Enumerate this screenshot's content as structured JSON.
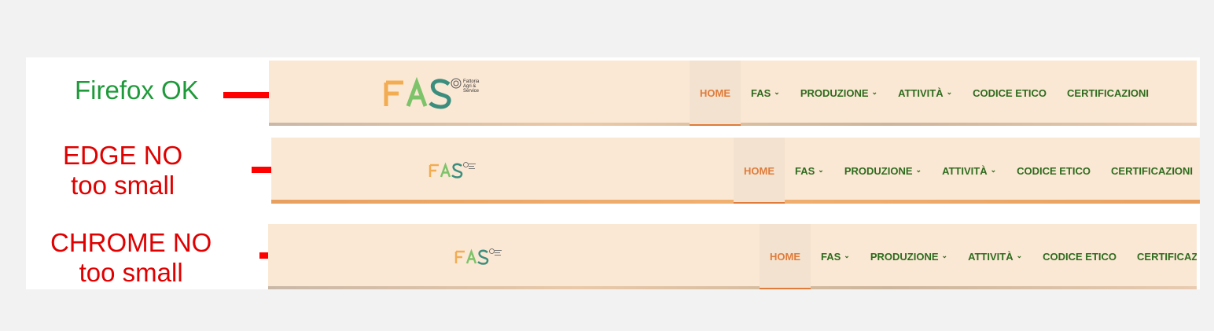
{
  "captions": {
    "firefox": {
      "line1": "Firefox OK",
      "line2": ""
    },
    "edge": {
      "line1": "EDGE NO",
      "line2": "too small"
    },
    "chrome": {
      "line1": "CHROME NO",
      "line2": "too small"
    }
  },
  "logo": {
    "letters": "FAS",
    "tagline_1": "Fattoria",
    "tagline_2": "Agri &",
    "tagline_3": "Service"
  },
  "nav": {
    "home": "HOME",
    "fas": "FAS",
    "produzione": "PRODUZIONE",
    "attivita": "ATTIVITÀ",
    "codice_etico": "CODICE ETICO",
    "certificazioni": "CERTIFICAZIONI",
    "chevron": "⌄"
  },
  "colors": {
    "ok": "#1e9a3a",
    "no": "#e00000",
    "header_bg": "#fbe8d4",
    "active": "#e07b39",
    "nav_text": "#2e6b1e"
  }
}
